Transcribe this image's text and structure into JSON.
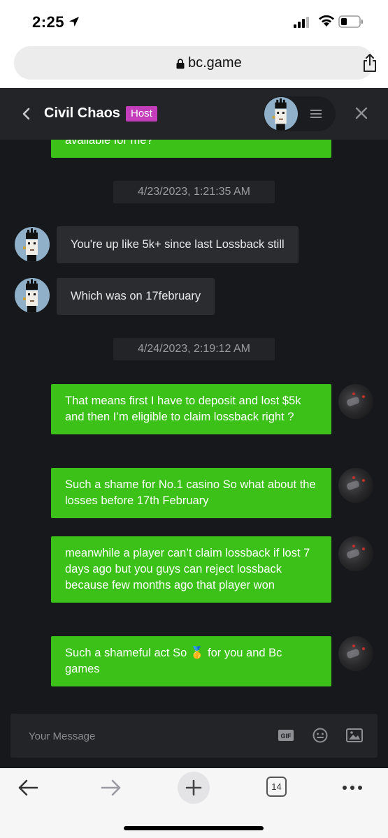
{
  "status_bar": {
    "time": "2:25"
  },
  "browser": {
    "url": "bc.game",
    "tab_count": "14"
  },
  "chat": {
    "title": "Civil Chaos",
    "badge": "Host"
  },
  "messages": {
    "m0": "available for me?",
    "ts1": "4/23/2023, 1:21:35 AM",
    "m1": "You're up like 5k+ since last Lossback still",
    "m2": "Which was on 17february",
    "ts2": "4/24/2023, 2:19:12 AM",
    "m3": "That means first I have to deposit and lost $5k and then I’m eligible to claim lossback right ?",
    "m4": "Such a shame for No.1 casino So what about the losses before 17th February",
    "m5": "meanwhile a player can’t claim lossback if lost 7 days ago but you guys can reject lossback because few months ago that player won",
    "m6_before": "Such a shameful act So ",
    "m6_emoji": "🥇",
    "m6_after": " for you and Bc games"
  },
  "composer": {
    "placeholder": "Your Message",
    "gif_label": "GIF"
  },
  "colors": {
    "accent_green": "#3bc117",
    "host_badge": "#c43dba",
    "background": "#17181b"
  }
}
